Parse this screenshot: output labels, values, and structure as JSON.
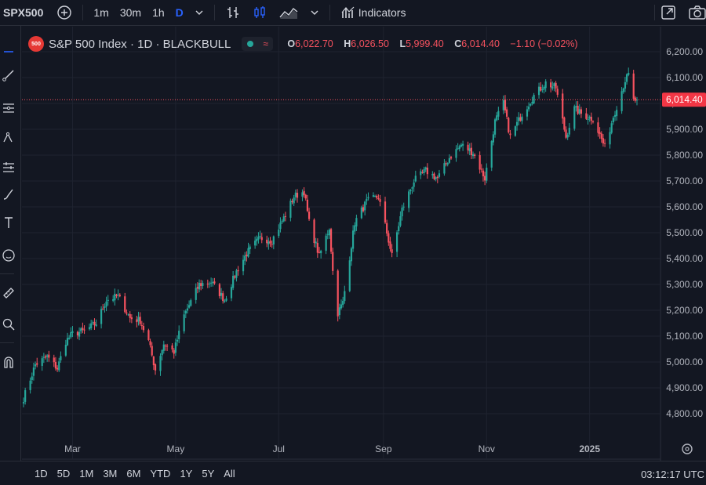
{
  "toolbar": {
    "symbol": "SPX500",
    "intervals": [
      "1m",
      "30m",
      "1h",
      "D"
    ],
    "indicators_label": "Indicators"
  },
  "legend": {
    "logo_text": "500",
    "title": "S&P 500 Index · 1D · BLACKBULL",
    "o_label": "O",
    "o_value": "6,022.70",
    "h_label": "H",
    "h_value": "6,026.50",
    "l_label": "L",
    "l_value": "5,999.40",
    "c_label": "C",
    "c_value": "6,014.40",
    "change": "−1.10 (−0.02%)"
  },
  "bottom": {
    "ranges": [
      "1D",
      "5D",
      "1M",
      "3M",
      "6M",
      "YTD",
      "1Y",
      "5Y",
      "All"
    ],
    "clock": "03:12:17 UTC"
  },
  "colors": {
    "up": "#26a69a",
    "down": "#f7525f",
    "accent": "#2962ff",
    "background": "#131722"
  },
  "chart_data": {
    "type": "candlestick",
    "title": "S&P 500 Index · 1D · BLACKBULL",
    "ylim": [
      4730,
      6240
    ],
    "y_ticks": [
      4800,
      4900,
      5000,
      5100,
      5200,
      5300,
      5400,
      5500,
      5600,
      5700,
      5800,
      5900,
      6000,
      6100,
      6200
    ],
    "y_tick_labels": [
      "4,800.00",
      "4,900.00",
      "5,000.00",
      "5,100.00",
      "5,200.00",
      "5,300.00",
      "5,400.00",
      "5,500.00",
      "5,600.00",
      "5,700.00",
      "5,800.00",
      "5,900.00",
      "6,000.00",
      "6,100.00",
      "6,200.00"
    ],
    "x_tick_labels": [
      {
        "label": "Mar",
        "date": "2024-03-01"
      },
      {
        "label": "May",
        "date": "2024-05-01"
      },
      {
        "label": "Jul",
        "date": "2024-07-01"
      },
      {
        "label": "Sep",
        "date": "2024-09-01"
      },
      {
        "label": "Nov",
        "date": "2024-11-01"
      },
      {
        "label": "2025",
        "date": "2025-01-01",
        "bold": true
      }
    ],
    "last_price": 6014.4,
    "last_price_label": "6,014.40",
    "grid": true,
    "close_path": [
      {
        "date": "2024-02-01",
        "close": 4860
      },
      {
        "date": "2024-02-08",
        "close": 4990
      },
      {
        "date": "2024-02-15",
        "close": 5020
      },
      {
        "date": "2024-02-21",
        "close": 4975
      },
      {
        "date": "2024-02-26",
        "close": 5080
      },
      {
        "date": "2024-03-01",
        "close": 5110
      },
      {
        "date": "2024-03-08",
        "close": 5120
      },
      {
        "date": "2024-03-15",
        "close": 5150
      },
      {
        "date": "2024-03-21",
        "close": 5240
      },
      {
        "date": "2024-03-28",
        "close": 5255
      },
      {
        "date": "2024-04-04",
        "close": 5170
      },
      {
        "date": "2024-04-10",
        "close": 5160
      },
      {
        "date": "2024-04-15",
        "close": 5080
      },
      {
        "date": "2024-04-19",
        "close": 4970
      },
      {
        "date": "2024-04-24",
        "close": 5070
      },
      {
        "date": "2024-04-30",
        "close": 5040
      },
      {
        "date": "2024-05-06",
        "close": 5180
      },
      {
        "date": "2024-05-15",
        "close": 5300
      },
      {
        "date": "2024-05-22",
        "close": 5310
      },
      {
        "date": "2024-05-30",
        "close": 5240
      },
      {
        "date": "2024-06-06",
        "close": 5350
      },
      {
        "date": "2024-06-12",
        "close": 5420
      },
      {
        "date": "2024-06-20",
        "close": 5480
      },
      {
        "date": "2024-06-27",
        "close": 5470
      },
      {
        "date": "2024-07-05",
        "close": 5570
      },
      {
        "date": "2024-07-10",
        "close": 5640
      },
      {
        "date": "2024-07-16",
        "close": 5660
      },
      {
        "date": "2024-07-19",
        "close": 5540
      },
      {
        "date": "2024-07-25",
        "close": 5410
      },
      {
        "date": "2024-07-31",
        "close": 5520
      },
      {
        "date": "2024-08-02",
        "close": 5350
      },
      {
        "date": "2024-08-05",
        "close": 5190
      },
      {
        "date": "2024-08-08",
        "close": 5230
      },
      {
        "date": "2024-08-15",
        "close": 5540
      },
      {
        "date": "2024-08-22",
        "close": 5620
      },
      {
        "date": "2024-08-29",
        "close": 5640
      },
      {
        "date": "2024-09-03",
        "close": 5500
      },
      {
        "date": "2024-09-06",
        "close": 5410
      },
      {
        "date": "2024-09-12",
        "close": 5590
      },
      {
        "date": "2024-09-19",
        "close": 5700
      },
      {
        "date": "2024-09-26",
        "close": 5740
      },
      {
        "date": "2024-10-03",
        "close": 5710
      },
      {
        "date": "2024-10-10",
        "close": 5790
      },
      {
        "date": "2024-10-17",
        "close": 5840
      },
      {
        "date": "2024-10-24",
        "close": 5810
      },
      {
        "date": "2024-10-31",
        "close": 5710
      },
      {
        "date": "2024-11-06",
        "close": 5930
      },
      {
        "date": "2024-11-11",
        "close": 6000
      },
      {
        "date": "2024-11-15",
        "close": 5870
      },
      {
        "date": "2024-11-22",
        "close": 5960
      },
      {
        "date": "2024-11-29",
        "close": 6030
      },
      {
        "date": "2024-12-06",
        "close": 6080
      },
      {
        "date": "2024-12-12",
        "close": 6060
      },
      {
        "date": "2024-12-18",
        "close": 5870
      },
      {
        "date": "2024-12-23",
        "close": 5980
      },
      {
        "date": "2024-12-27",
        "close": 5960
      },
      {
        "date": "2025-01-03",
        "close": 5940
      },
      {
        "date": "2025-01-10",
        "close": 5830
      },
      {
        "date": "2025-01-15",
        "close": 5950
      },
      {
        "date": "2025-01-22",
        "close": 6090
      },
      {
        "date": "2025-01-24",
        "close": 6110
      },
      {
        "date": "2025-01-27",
        "close": 6010
      },
      {
        "date": "2025-01-29",
        "close": 6014
      }
    ]
  }
}
